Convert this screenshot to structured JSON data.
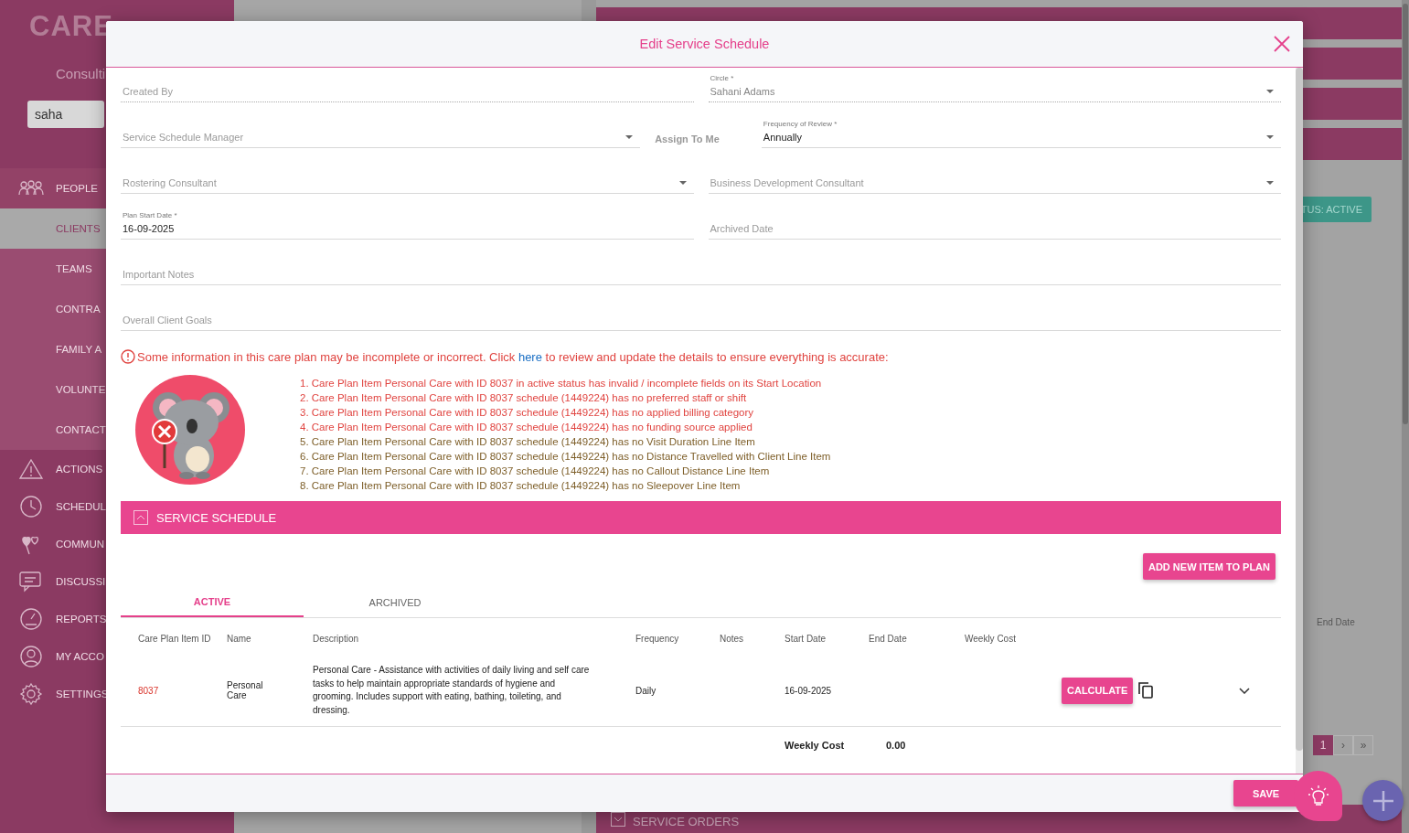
{
  "sidebar": {
    "logo": "CARE",
    "subtitle": "Consulti",
    "search": {
      "value": "saha"
    },
    "items": [
      {
        "label": "PEOPLE",
        "selected": false,
        "children": [
          {
            "label": "CLIENTS",
            "selected": true
          },
          {
            "label": "TEAMS",
            "selected": false
          },
          {
            "label": "CONTRA",
            "selected": false
          },
          {
            "label": "FAMILY A",
            "selected": false
          },
          {
            "label": "VOLUNTE",
            "selected": false
          },
          {
            "label": "CONTACT",
            "selected": false
          }
        ]
      },
      {
        "label": "ACTIONS",
        "selected": false
      },
      {
        "label": "SCHEDUL",
        "selected": false
      },
      {
        "label": "COMMUN",
        "selected": false
      },
      {
        "label": "DISCUSSI",
        "selected": false
      },
      {
        "label": "REPORTS",
        "selected": false
      },
      {
        "label": "MY ACCO",
        "selected": false
      },
      {
        "label": "SETTINGS",
        "selected": false
      }
    ]
  },
  "background": {
    "status_button": "TUS: ACTIVE",
    "column_header": "End Date",
    "pagination": [
      {
        "label": "1",
        "selected": true
      },
      {
        "label": "›",
        "selected": false
      },
      {
        "label": "»",
        "selected": false
      }
    ],
    "section_title": "SERVICE ORDERS"
  },
  "dialog": {
    "title": "Edit Service Schedule",
    "form_rows": [
      [
        {
          "kind": "text",
          "placeholder": "Created By",
          "disabled": true
        },
        {
          "kind": "select",
          "label": "Circle *",
          "value": "Sahani Adams",
          "disabled": true
        }
      ],
      [
        {
          "kind": "select",
          "placeholder": "Service Schedule Manager",
          "disabled": false
        },
        {
          "kind": "link",
          "text": "Assign To Me",
          "disabled": false
        },
        {
          "kind": "select",
          "label": "Frequency of Review *",
          "value": "Annually",
          "disabled": false
        }
      ],
      [
        {
          "kind": "select",
          "placeholder": "Rostering Consultant",
          "disabled": false
        },
        {
          "kind": "select",
          "placeholder": "Business Development Consultant",
          "disabled": false
        }
      ],
      [
        {
          "kind": "text",
          "label": "Plan Start Date *",
          "value": "16-09-2025",
          "disabled": false
        },
        {
          "kind": "text",
          "placeholder": "Archived Date",
          "disabled": false
        }
      ],
      [
        {
          "kind": "text",
          "placeholder": "Important Notes",
          "disabled": false
        }
      ],
      [
        {
          "kind": "text",
          "placeholder": "Overall Client Goals",
          "disabled": false
        }
      ]
    ],
    "warning": {
      "text_before": "Some information in this care plan may be incomplete or incorrect. Click ",
      "link": "here",
      "text_after": " to review and update the details to ensure everything is accurate:"
    },
    "issues": [
      {
        "text": "1. Care Plan Item Personal Care with ID 8037 in active status has invalid / incomplete fields on its Start Location",
        "color": "#e0433f"
      },
      {
        "text": "2. Care Plan Item Personal Care with ID 8037 schedule (1449224) has no preferred staff or shift",
        "color": "#e0433f"
      },
      {
        "text": "3. Care Plan Item Personal Care with ID 8037 schedule (1449224) has no applied billing category",
        "color": "#e0433f"
      },
      {
        "text": "4. Care Plan Item Personal Care with ID 8037 schedule (1449224) has no funding source applied",
        "color": "#e0433f"
      },
      {
        "text": "5. Care Plan Item Personal Care with ID 8037 schedule (1449224) has no Visit Duration Line Item",
        "color": "#7d5e28"
      },
      {
        "text": "6. Care Plan Item Personal Care with ID 8037 schedule (1449224) has no Distance Travelled with Client Line Item",
        "color": "#7d5e28"
      },
      {
        "text": "7. Care Plan Item Personal Care with ID 8037 schedule (1449224) has no Callout Distance Line Item",
        "color": "#7d5e28"
      },
      {
        "text": "8. Care Plan Item Personal Care with ID 8037 schedule (1449224) has no Sleepover Line Item",
        "color": "#7d5e28"
      }
    ],
    "service_schedule": {
      "title": "SERVICE SCHEDULE",
      "expanded": true,
      "add_button": "ADD NEW ITEM TO PLAN",
      "tabs": [
        {
          "label": "ACTIVE",
          "selected": true
        },
        {
          "label": "ARCHIVED",
          "selected": false
        }
      ],
      "table": {
        "columns": [
          "Care Plan Item ID",
          "Name",
          "Description",
          "Frequency",
          "Notes",
          "Start Date",
          "End Date",
          "Weekly Cost"
        ],
        "rows": [
          {
            "id": "8037",
            "name": "Personal Care",
            "description": "Personal Care - Assistance with activities of daily living and self care tasks to help maintain appropriate standards of hygiene and grooming. Includes support with eating, bathing, toileting, and dressing.",
            "frequency": "Daily",
            "start_date": "16-09-2025",
            "action": "CALCULATE"
          }
        ],
        "total": {
          "label": "Weekly Cost",
          "value": "0.00"
        }
      }
    },
    "save_button": "SAVE"
  }
}
